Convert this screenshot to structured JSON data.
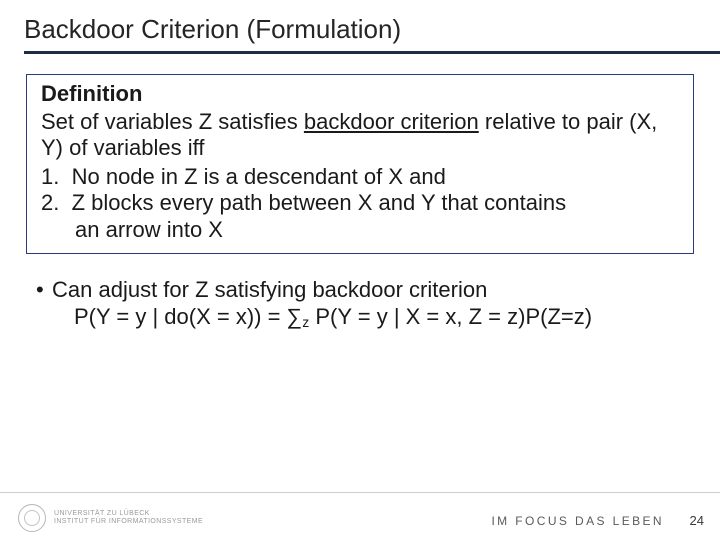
{
  "title": "Backdoor Criterion (Formulation)",
  "definition": {
    "heading": "Definition",
    "intro_l1": "Set of variables Z satisfies ",
    "intro_underlined": "backdoor criterion",
    "intro_l2": " relative to pair (X, Y) of variables iff",
    "items": [
      {
        "num": "1.",
        "text": "No node in Z is a descendant of X and"
      },
      {
        "num": "2.",
        "text": "Z blocks every path between X and Y that contains",
        "cont": "an arrow into X"
      }
    ]
  },
  "bullets": [
    {
      "lead": "•",
      "text": "Can adjust for Z satisfying backdoor criterion",
      "formula_prefix": "P(Y = y | do(X = x)) = ∑",
      "formula_sub": "z",
      "formula_suffix": " P(Y = y | X = x, Z = z)P(Z=z)"
    }
  ],
  "footer": {
    "uni_line1": "UNIVERSITÄT ZU LÜBECK",
    "uni_line2": "INSTITUT FÜR INFORMATIONSSYSTEME",
    "motto": "IM FOCUS DAS LEBEN",
    "page": "24"
  }
}
